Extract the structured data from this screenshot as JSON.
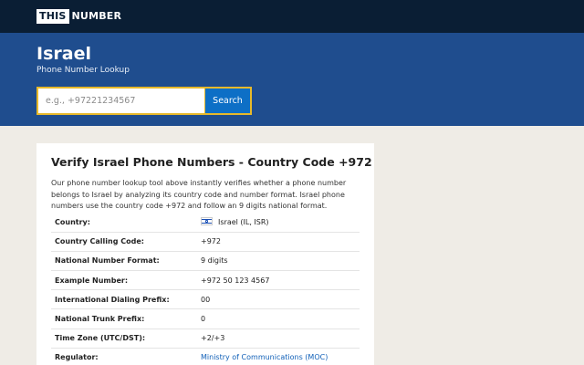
{
  "topbar": {
    "logo_box": "THIS",
    "logo_rest": "NUMBER"
  },
  "hero": {
    "title": "Israel",
    "subtitle": "Phone Number Lookup",
    "search_placeholder": "e.g., +97221234567",
    "search_button": "Search"
  },
  "card": {
    "title": "Verify Israel Phone Numbers - Country Code +972",
    "description": "Our phone number lookup tool above instantly verifies whether a phone number belongs to Israel by analyzing its country code and number format. Israel phone numbers use the country code +972 and follow an 9 digits national format.",
    "rows": [
      {
        "label": "Country:",
        "value": "Israel (IL, ISR)"
      },
      {
        "label": "Country Calling Code:",
        "value": "+972"
      },
      {
        "label": "National Number Format:",
        "value": "9 digits"
      },
      {
        "label": "Example Number:",
        "value": "+972 50 123 4567"
      },
      {
        "label": "International Dialing Prefix:",
        "value": "00"
      },
      {
        "label": "National Trunk Prefix:",
        "value": "0"
      },
      {
        "label": "Time Zone (UTC/DST):",
        "value": "+2/+3"
      },
      {
        "label": "Regulator:",
        "value": "Ministry of Communications (MOC)"
      }
    ]
  },
  "colors": {
    "topbar": "#0a1e34",
    "hero": "#1f4d8e",
    "accent_border": "#e7b92a",
    "button": "#0d6fc6",
    "link": "#1160b8"
  }
}
